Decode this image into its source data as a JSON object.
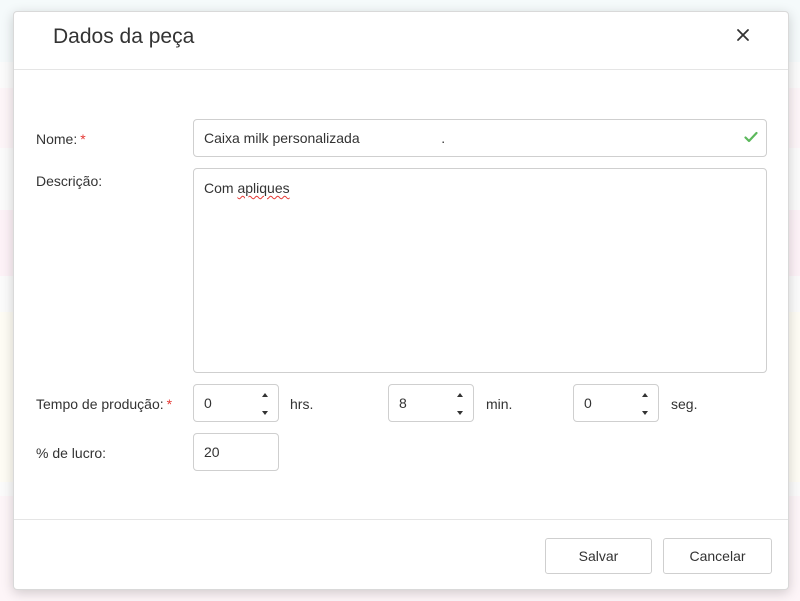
{
  "modal": {
    "title": "Dados da peça",
    "close_icon": "close-icon"
  },
  "form": {
    "name": {
      "label": "Nome:",
      "required_mark": "*",
      "value": "Caixa milk personalizada                     .",
      "valid_icon": "check-icon",
      "valid_color": "#5cb85c"
    },
    "description": {
      "label": "Descrição:",
      "value_prefix": "Com ",
      "value_misspelled": "apliques"
    },
    "production_time": {
      "label": "Tempo de produção:",
      "required_mark": "*",
      "hours": {
        "value": "0",
        "unit": "hrs."
      },
      "minutes": {
        "value": "8",
        "unit": "min."
      },
      "seconds": {
        "value": "0",
        "unit": "seg."
      }
    },
    "profit": {
      "label": "% de lucro:",
      "value": "20"
    }
  },
  "footer": {
    "save_label": "Salvar",
    "cancel_label": "Cancelar"
  },
  "colors": {
    "required": "#e53935",
    "border": "#cfcfcf"
  }
}
